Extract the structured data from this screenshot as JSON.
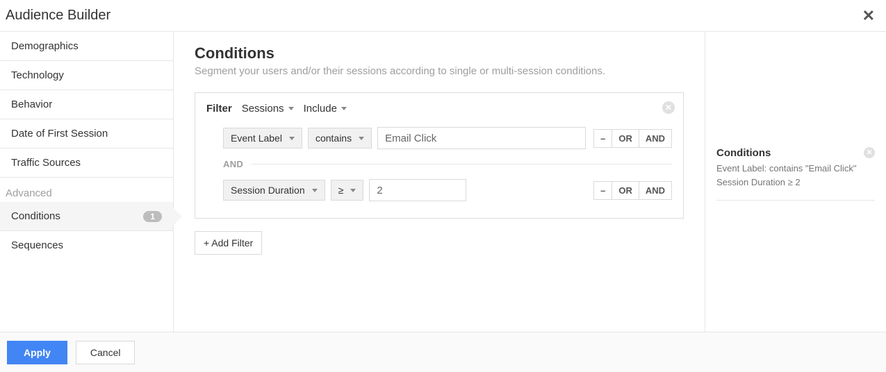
{
  "header": {
    "title": "Audience Builder"
  },
  "sidebar": {
    "items": [
      {
        "label": "Demographics"
      },
      {
        "label": "Technology"
      },
      {
        "label": "Behavior"
      },
      {
        "label": "Date of First Session"
      },
      {
        "label": "Traffic Sources"
      }
    ],
    "advanced_label": "Advanced",
    "advanced_items": [
      {
        "label": "Conditions",
        "badge": "1",
        "active": true
      },
      {
        "label": "Sequences"
      }
    ]
  },
  "main": {
    "title": "Conditions",
    "subtitle": "Segment your users and/or their sessions according to single or multi-session conditions.",
    "filter": {
      "label": "Filter",
      "scope": "Sessions",
      "mode": "Include",
      "rows": [
        {
          "dimension": "Event Label",
          "operator": "contains",
          "value": "Email Click"
        },
        {
          "dimension": "Session Duration",
          "operator": "≥",
          "value": "2"
        }
      ],
      "conjunction": "AND",
      "ops": {
        "remove": "–",
        "or": "OR",
        "and": "AND"
      }
    },
    "add_filter": "+ Add Filter"
  },
  "summary": {
    "title": "Conditions",
    "lines": [
      "Event Label: contains \"Email Click\"",
      "Session Duration ≥ 2"
    ]
  },
  "footer": {
    "apply": "Apply",
    "cancel": "Cancel"
  }
}
